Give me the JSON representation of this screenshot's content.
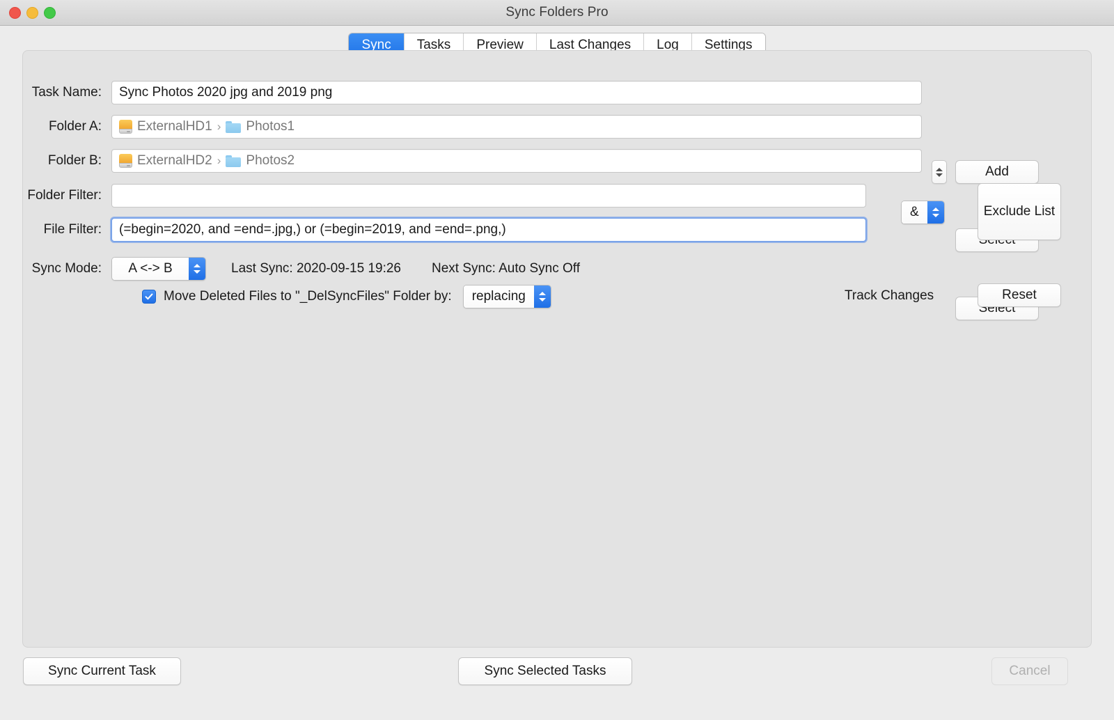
{
  "window": {
    "title": "Sync Folders Pro",
    "traffic_lights": [
      "close-red",
      "minimize-yellow",
      "zoom-green"
    ]
  },
  "tabs": [
    {
      "label": "Sync",
      "active": true
    },
    {
      "label": "Tasks",
      "active": false
    },
    {
      "label": "Preview",
      "active": false
    },
    {
      "label": "Last Changes",
      "active": false
    },
    {
      "label": "Log",
      "active": false
    },
    {
      "label": "Settings",
      "active": false
    }
  ],
  "form": {
    "task_name": {
      "label": "Task Name:",
      "value": "Sync Photos 2020 jpg and 2019 png",
      "button": "Add"
    },
    "folder_a": {
      "label": "Folder A:",
      "drive": "ExternalHD1",
      "separator": "›",
      "folder": "Photos1",
      "button": "Select"
    },
    "folder_b": {
      "label": "Folder B:",
      "drive": "ExternalHD2",
      "separator": "›",
      "folder": "Photos2",
      "button": "Select"
    },
    "folder_filter": {
      "label": "Folder Filter:",
      "value": "",
      "placeholder": ""
    },
    "logic_operator": {
      "value": "&"
    },
    "exclude_list_button": "Exclude List",
    "file_filter": {
      "label": "File Filter:",
      "value": "(=begin=2020, and =end=.jpg,) or (=begin=2019, and =end=.png,)",
      "focused": true
    },
    "sync_mode": {
      "label": "Sync Mode:",
      "value": "A <-> B"
    },
    "last_sync": "Last Sync: 2020-09-15 19:26",
    "next_sync": "Next Sync: Auto Sync Off",
    "move_deleted": {
      "checked": true,
      "label": "Move Deleted Files to \"_DelSyncFiles\" Folder by:",
      "mode": "replacing"
    },
    "track_changes_label": "Track Changes",
    "reset_button": "Reset"
  },
  "bottom": {
    "sync_current": "Sync Current Task",
    "sync_selected": "Sync Selected Tasks",
    "cancel": "Cancel",
    "cancel_disabled": true
  },
  "colors": {
    "accent": "#1f73e8",
    "window_bg": "#ececec",
    "panel_bg": "#e3e3e3",
    "drive_icon": "#f0a52f",
    "folder_icon": "#8cc9ee"
  }
}
